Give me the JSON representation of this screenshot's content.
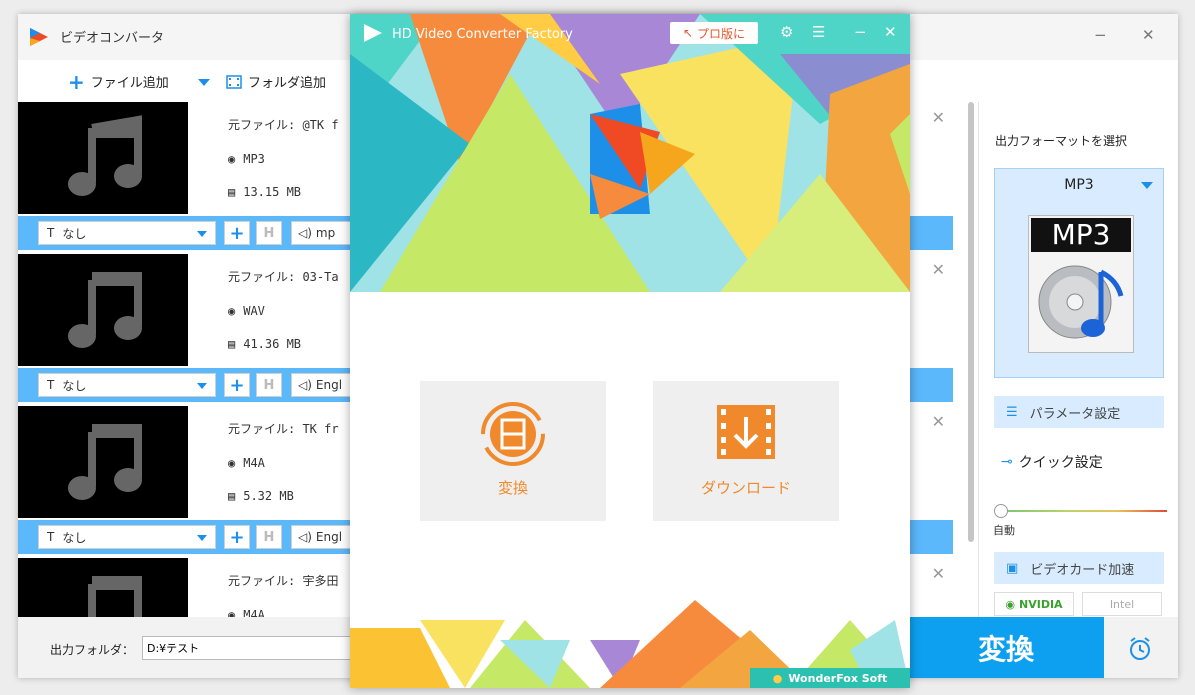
{
  "bg_window": {
    "title": "ビデオコンバータ",
    "minimize": "−",
    "close": "✕"
  },
  "toolbar": {
    "add_file": "ファイル追加",
    "add_folder": "フォルダ追加"
  },
  "items": [
    {
      "source": "元ファイル: @TK f",
      "format": "MP3",
      "size": "13.15 MB",
      "subtitle": "なし",
      "audio": "mp"
    },
    {
      "source": "元ファイル: 03-Ta",
      "format": "WAV",
      "size": "41.36 MB",
      "subtitle": "なし",
      "audio": "Engl"
    },
    {
      "source": "元ファイル: TK fr",
      "format": "M4A",
      "size": "5.32 MB",
      "subtitle": "なし",
      "audio": "Engl"
    },
    {
      "source": "元ファイル: 宇多田",
      "format": "M4A",
      "size": "",
      "subtitle": "",
      "audio": ""
    }
  ],
  "right_panel": {
    "title": "出力フォーマットを選択",
    "format": "MP3",
    "format_icon_label": "MP3",
    "param_btn": "パラメータ設定",
    "quick": "クイック設定",
    "slider_label": "自動",
    "gpu_btn": "ビデオカード加速",
    "nvidia": "NVIDIA",
    "intel": "Intel"
  },
  "bottom": {
    "out_label": "出力フォルダ：",
    "out_path": "D:¥テスト",
    "convert": "変換"
  },
  "front": {
    "title": "HD Video Converter Factory",
    "pro_btn": "プロ版に",
    "convert_card": "変換",
    "download_card": "ダウンロード",
    "brand": "WonderFox Soft"
  },
  "colors": {
    "accent_blue": "#0ea0f0",
    "list_bar_blue": "#5bb8fb",
    "orange": "#f0892b"
  }
}
